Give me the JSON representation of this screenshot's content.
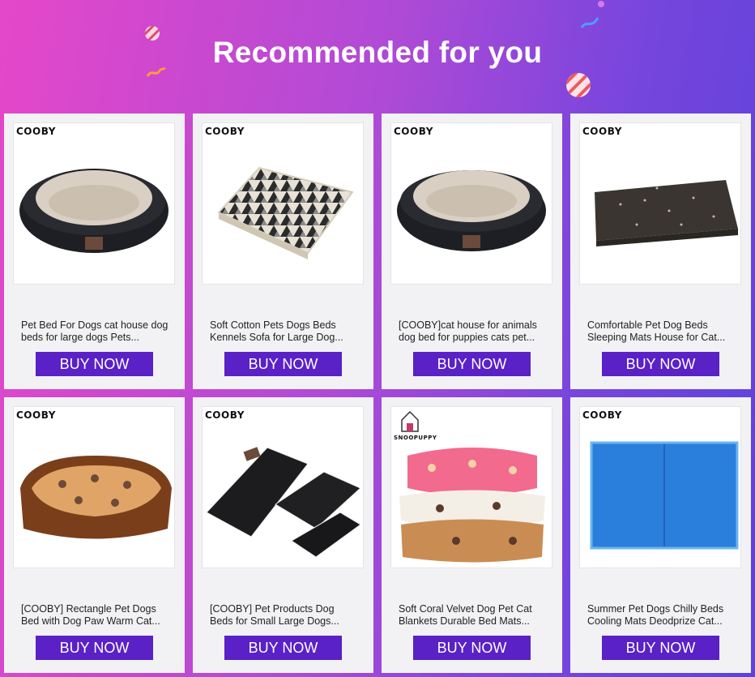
{
  "banner": {
    "title": "Recommended for you"
  },
  "products": [
    {
      "title": "Pet Bed For Dogs cat house dog beds for large dogs Pets...",
      "brand": "COOBY",
      "button": "BUY NOW",
      "image": "oval-dog-bed-black"
    },
    {
      "title": "Soft Cotton Pets Dogs Beds Kennels Sofa for Large Dog...",
      "brand": "COOBY",
      "button": "BUY NOW",
      "image": "triangle-pattern-pet-mat"
    },
    {
      "title": "[COOBY]cat house for animals dog bed for puppies cats pet...",
      "brand": "COOBY",
      "button": "BUY NOW",
      "image": "oval-dog-bed-black"
    },
    {
      "title": "Comfortable Pet Dog Beds Sleeping Mats House for Cat...",
      "brand": "COOBY",
      "button": "BUY NOW",
      "image": "dark-pet-mat"
    },
    {
      "title": "[COOBY] Rectangle Pet Dogs Bed with Dog Paw Warm Cat...",
      "brand": "COOBY",
      "button": "BUY NOW",
      "image": "paw-print-rectangle-bed"
    },
    {
      "title": "[COOBY] Pet Products Dog Beds for Small Large Dogs...",
      "brand": "COOBY",
      "button": "BUY NOW",
      "image": "stacked-black-mats"
    },
    {
      "title": "Soft Coral Velvet Dog Pet Cat Blankets Durable Bed Mats...",
      "brand": "SNOOPUPPY",
      "button": "BUY NOW",
      "image": "folded-paw-blankets"
    },
    {
      "title": "Summer Pet Dogs Chilly Beds Cooling Mats Deodprize Cat...",
      "brand": "COOBY",
      "button": "BUY NOW",
      "image": "blue-cooling-mat"
    }
  ],
  "colors": {
    "button": "#5a21c6",
    "card": "#f2f2f4",
    "banner_start": "#e547c9",
    "banner_end": "#5b43db"
  }
}
